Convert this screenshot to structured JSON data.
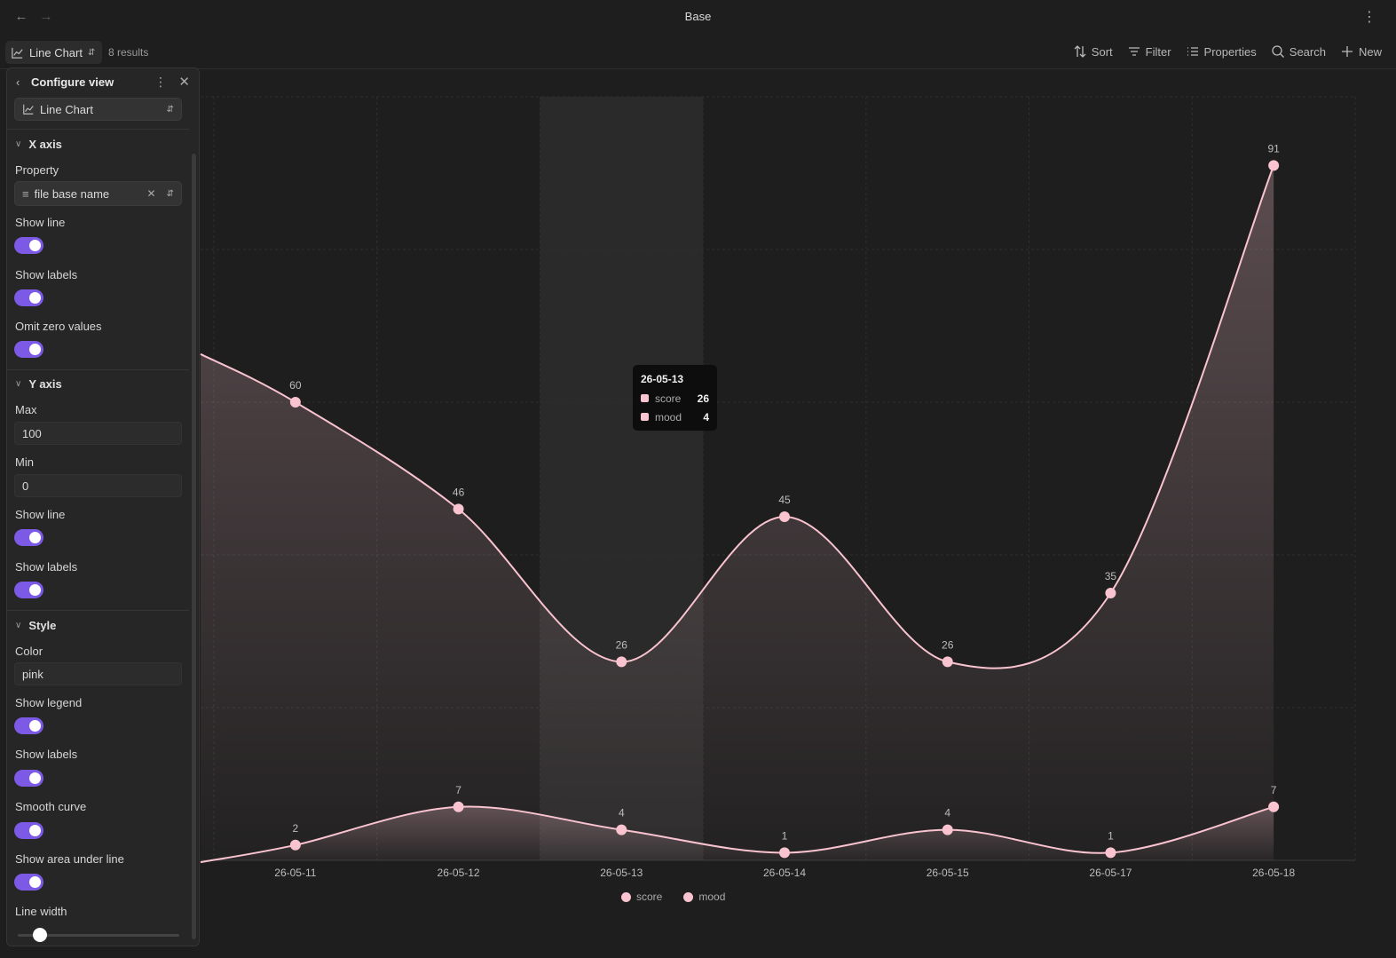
{
  "window": {
    "title": "Base"
  },
  "toolbar": {
    "view_label": "Line Chart",
    "results": "8 results",
    "actions": {
      "sort": "Sort",
      "filter": "Filter",
      "properties": "Properties",
      "search": "Search",
      "new": "New"
    }
  },
  "panel": {
    "title": "Configure view",
    "view_type": "Line Chart",
    "x_axis": {
      "title": "X axis",
      "property_label": "Property",
      "property_value": "file base name",
      "show_line": "Show line",
      "show_labels": "Show labels",
      "omit_zero": "Omit zero values"
    },
    "y_axis": {
      "title": "Y axis",
      "max_label": "Max",
      "max_value": "100",
      "min_label": "Min",
      "min_value": "0",
      "show_line": "Show line",
      "show_labels": "Show labels"
    },
    "style": {
      "title": "Style",
      "color_label": "Color",
      "color_value": "pink",
      "show_legend": "Show legend",
      "show_labels": "Show labels",
      "smooth_curve": "Smooth curve",
      "show_area": "Show area under line",
      "line_width": "Line width"
    }
  },
  "tooltip": {
    "title": "26-05-13",
    "rows": [
      {
        "name": "score",
        "value": "26"
      },
      {
        "name": "mood",
        "value": "4"
      }
    ]
  },
  "legend": {
    "items": [
      "score",
      "mood"
    ]
  },
  "colors": {
    "accent": "#7d5ae6",
    "series": "#f9c3cf",
    "background": "#1e1e1e"
  },
  "chart_data": {
    "type": "line",
    "categories": [
      "26-05-11",
      "26-05-12",
      "26-05-13",
      "26-05-14",
      "26-05-15",
      "26-05-17",
      "26-05-18"
    ],
    "series": [
      {
        "name": "score",
        "values": [
          60,
          46,
          26,
          45,
          26,
          35,
          91
        ]
      },
      {
        "name": "mood",
        "values": [
          2,
          7,
          4,
          1,
          4,
          1,
          7
        ]
      }
    ],
    "ylim": [
      0,
      100
    ],
    "grid": true,
    "legend": "bottom-center",
    "smooth": true,
    "area": true,
    "highlighted_category": "26-05-13"
  }
}
